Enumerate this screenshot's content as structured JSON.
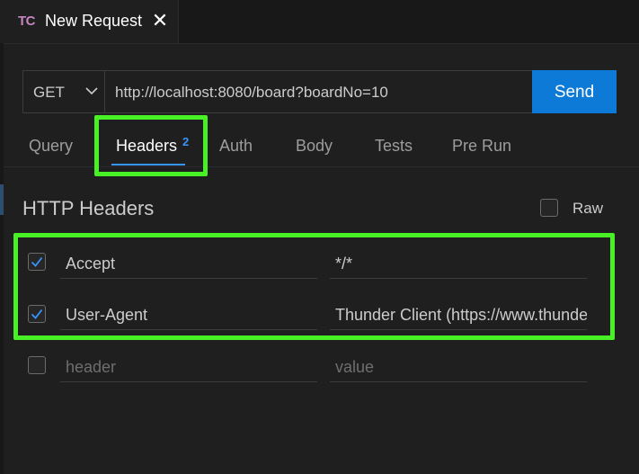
{
  "editor_tab": {
    "logo": "TC",
    "title": "New Request",
    "close_glyph": "✕"
  },
  "request": {
    "method": "GET",
    "url": "http://localhost:8080/board?boardNo=10",
    "send_label": "Send"
  },
  "request_tabs": [
    {
      "label": "Query",
      "active": false
    },
    {
      "label": "Headers",
      "active": true,
      "badge": "2"
    },
    {
      "label": "Auth",
      "active": false
    },
    {
      "label": "Body",
      "active": false
    },
    {
      "label": "Tests",
      "active": false
    },
    {
      "label": "Pre Run",
      "active": false
    }
  ],
  "headers_panel": {
    "title": "HTTP Headers",
    "raw_label": "Raw",
    "raw_checked": false,
    "rows": [
      {
        "checked": true,
        "key": "Accept",
        "value": "*/*"
      },
      {
        "checked": true,
        "key": "User-Agent",
        "value": "Thunder Client (https://www.thunderclient.com)"
      }
    ],
    "new_row": {
      "checked": false,
      "key_placeholder": "header",
      "value_placeholder": "value"
    }
  },
  "colors": {
    "accent": "#0e7ad7",
    "highlight": "#47f125",
    "tab_active_underline": "#3794ff",
    "logo": "#c586c0"
  },
  "icons": {
    "method_dropdown": "chevron-down-icon",
    "checkbox_checked": "check-icon",
    "tab_close": "close-icon"
  }
}
